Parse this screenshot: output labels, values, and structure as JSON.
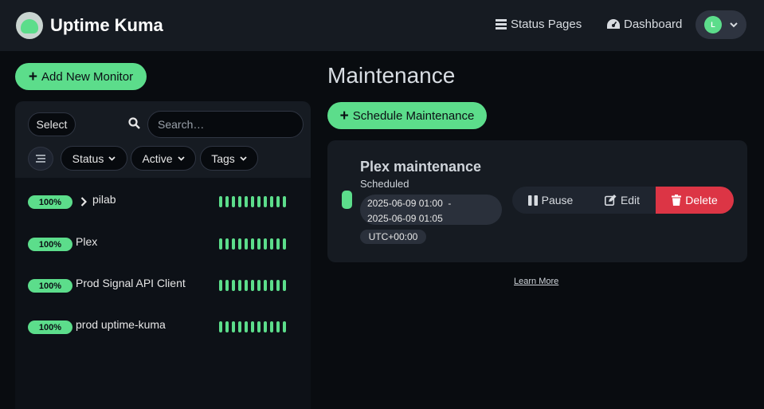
{
  "header": {
    "app_name": "Uptime Kuma",
    "nav": [
      {
        "label": "Status Pages",
        "icon": "list-icon"
      },
      {
        "label": "Dashboard",
        "icon": "tachometer-icon"
      }
    ],
    "profile": {
      "initial": "L",
      "icon": "chevron-down-icon"
    }
  },
  "sidebar": {
    "add_button_label": "Add New Monitor",
    "select_label": "Select",
    "search_placeholder": "Search…",
    "filters": [
      {
        "label": "Status"
      },
      {
        "label": "Active"
      },
      {
        "label": "Tags"
      }
    ],
    "monitors": [
      {
        "uptime": "100%",
        "name": "pilab",
        "group": true
      },
      {
        "uptime": "100%",
        "name": "Plex",
        "group": false
      },
      {
        "uptime": "100%",
        "name": "Prod Signal API Client",
        "group": false
      },
      {
        "uptime": "100%",
        "name": "prod uptime-kuma",
        "group": false
      }
    ]
  },
  "main": {
    "title": "Maintenance",
    "schedule_button_label": "Schedule Maintenance",
    "maintenance": {
      "title": "Plex maintenance",
      "status": "Scheduled",
      "start": "2025-06-09 01:00",
      "separator": "-",
      "end": "2025-06-09 01:05",
      "timezone": "UTC+00:00",
      "actions": {
        "pause": "Pause",
        "edit": "Edit",
        "delete": "Delete"
      }
    },
    "learn_more": "Learn More"
  },
  "colors": {
    "accent": "#5cdd8b",
    "danger": "#dc3545",
    "background": "#090c10",
    "panel": "#161b22"
  }
}
